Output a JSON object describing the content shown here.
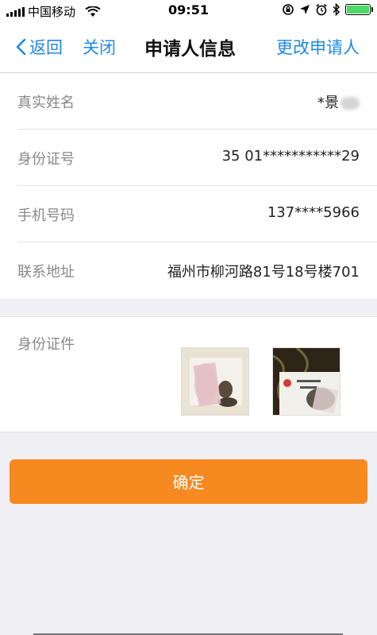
{
  "status_bar": {
    "carrier": "中国移动",
    "time": "09:51"
  },
  "nav": {
    "back_label": "返回",
    "close_label": "关闭",
    "title": "申请人信息",
    "change_label": "更改申请人"
  },
  "info": {
    "rows": [
      {
        "label": "真实姓名",
        "value": "*景"
      },
      {
        "label": "身份证号",
        "value": "35  01***********29"
      },
      {
        "label": "手机号码",
        "value": "137****5966"
      },
      {
        "label": "联系地址",
        "value": "福州市柳河路81号18号楼701"
      }
    ]
  },
  "id_section": {
    "label": "身份证件"
  },
  "confirm_label": "确定",
  "colors": {
    "accent": "#1e88e5",
    "button": "#f6891f",
    "battery": "#4cd964"
  }
}
